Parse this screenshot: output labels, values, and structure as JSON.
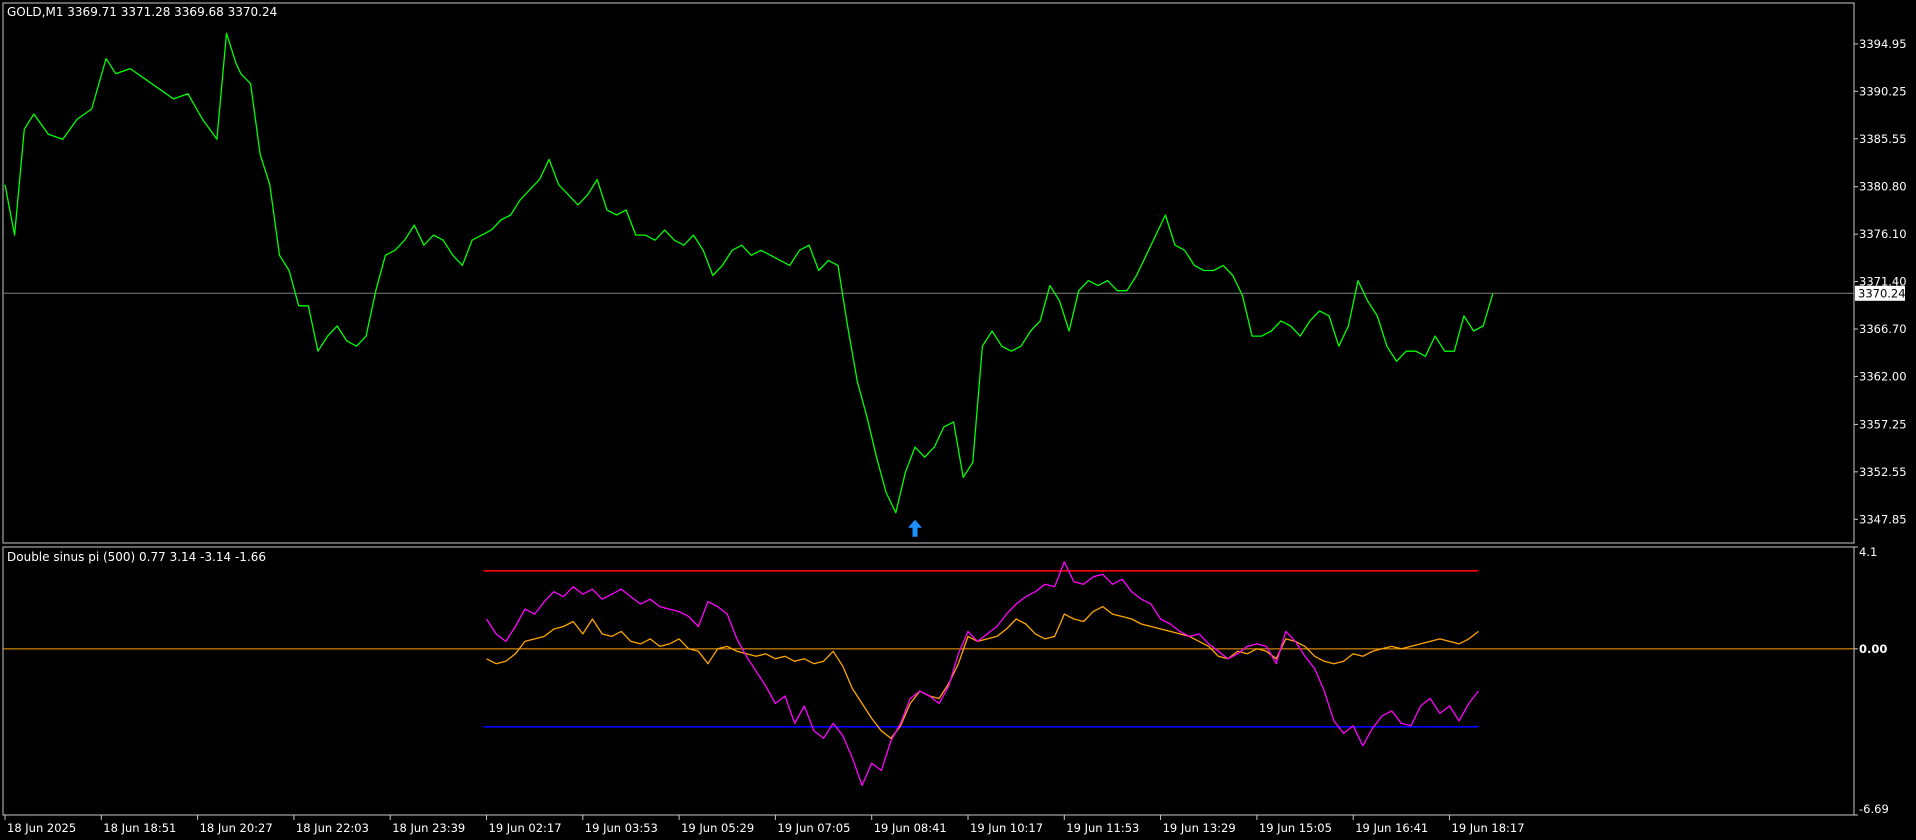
{
  "window": {
    "symbol_header": "GOLD,M1  3369.71 3371.28 3369.68 3370.24"
  },
  "colors": {
    "background": "#000000",
    "frame": "#c8c8c8",
    "price_line": "#00ff00",
    "current_price_line": "#7f7f7f",
    "price_tag_bg": "#ffffff",
    "price_tag_fg": "#000000",
    "arrow": "#1e90ff",
    "upper_level": "#ff0000",
    "lower_level": "#0000ff",
    "zero_level": "#ffa500",
    "series_a": "#ff00ff",
    "series_b": "#ffa500",
    "text": "#ffffff"
  },
  "chart_data": [
    {
      "type": "line",
      "title": "GOLD,M1  3369.71 3371.28 3369.68 3370.24",
      "ylim": [
        3345.5,
        3399.0
      ],
      "y_ticks": [
        "3394.95",
        "3390.25",
        "3385.55",
        "3380.80",
        "3376.10",
        "3371.40",
        "3366.70",
        "3362.00",
        "3357.25",
        "3352.55",
        "3347.85"
      ],
      "current_price": 3370.24,
      "current_price_label": "3370.24",
      "x_labels": [
        "18 Jun 2025",
        "18 Jun 18:51",
        "18 Jun 20:27",
        "18 Jun 22:03",
        "18 Jun 23:39",
        "19 Jun 02:17",
        "19 Jun 03:53",
        "19 Jun 05:29",
        "19 Jun 07:05",
        "19 Jun 08:41",
        "19 Jun 10:17",
        "19 Jun 11:53",
        "19 Jun 13:29",
        "19 Jun 15:05",
        "19 Jun 16:41",
        "19 Jun 18:17"
      ],
      "x_range": [
        0,
        15.78
      ],
      "arrow_marker": {
        "x": 9.45,
        "y": 3347.3,
        "type": "buy-arrow-up"
      },
      "series": [
        {
          "x": [
            0,
            0.1,
            0.2,
            0.3,
            0.45,
            0.6,
            0.75,
            0.9,
            1.05,
            1.15,
            1.3,
            1.45,
            1.6,
            1.75,
            1.9,
            2.05,
            2.2,
            2.3,
            2.4,
            2.45,
            2.55,
            2.65,
            2.75,
            2.85,
            2.95,
            3.05,
            3.15,
            3.25,
            3.35,
            3.45,
            3.55,
            3.65,
            3.75,
            3.85,
            3.95,
            4.05,
            4.15,
            4.25,
            4.35,
            4.45,
            4.55,
            4.65,
            4.75,
            4.85,
            4.95,
            5.05,
            5.15,
            5.25,
            5.35,
            5.45,
            5.55,
            5.65,
            5.75,
            5.85,
            5.95,
            6.05,
            6.15,
            6.25,
            6.35,
            6.45,
            6.55,
            6.65,
            6.75,
            6.85,
            6.95,
            7.05,
            7.15,
            7.25,
            7.35,
            7.45,
            7.55,
            7.65,
            7.75,
            7.85,
            7.95,
            8.05,
            8.15,
            8.25,
            8.35,
            8.45,
            8.55,
            8.65,
            8.75,
            8.85,
            8.95,
            9.05,
            9.15,
            9.25,
            9.35,
            9.45,
            9.55,
            9.65,
            9.75,
            9.85,
            9.95,
            10.05,
            10.15,
            10.25,
            10.35,
            10.45,
            10.55,
            10.65,
            10.75,
            10.85,
            10.95,
            11.05,
            11.15,
            11.25,
            11.35,
            11.45,
            11.55,
            11.65,
            11.75,
            11.85,
            11.95,
            12.05,
            12.15,
            12.25,
            12.35,
            12.45,
            12.55,
            12.65,
            12.75,
            12.85,
            12.95,
            13.05,
            13.15,
            13.25,
            13.35,
            13.45,
            13.55,
            13.65,
            13.75,
            13.85,
            13.95,
            14.05,
            14.15,
            14.25,
            14.35,
            14.45,
            14.55,
            14.65,
            14.75,
            14.85,
            14.95,
            15.05,
            15.15,
            15.25,
            15.35,
            15.45
          ],
          "values": [
            3381.0,
            3376.0,
            3386.5,
            3388.0,
            3386.0,
            3385.5,
            3387.5,
            3388.5,
            3393.5,
            3392.0,
            3392.5,
            3391.5,
            3390.5,
            3389.5,
            3390.0,
            3387.5,
            3385.5,
            3396.0,
            3393.0,
            3392.0,
            3391.0,
            3384.0,
            3381.0,
            3374.0,
            3372.5,
            3369.0,
            3369.0,
            3364.5,
            3366.0,
            3367.0,
            3365.5,
            3365.0,
            3366.0,
            3370.5,
            3374.0,
            3374.5,
            3375.5,
            3377.0,
            3375.0,
            3376.0,
            3375.5,
            3374.0,
            3373.0,
            3375.5,
            3376.0,
            3376.5,
            3377.5,
            3378.0,
            3379.5,
            3380.5,
            3381.5,
            3383.5,
            3381.0,
            3380.0,
            3379.0,
            3380.0,
            3381.5,
            3378.5,
            3378.0,
            3378.5,
            3376.0,
            3376.0,
            3375.5,
            3376.5,
            3375.5,
            3375.0,
            3376.0,
            3374.5,
            3372.0,
            3373.0,
            3374.5,
            3375.0,
            3374.0,
            3374.5,
            3374.0,
            3373.5,
            3373.0,
            3374.5,
            3375.0,
            3372.5,
            3373.5,
            3373.0,
            3367.0,
            3361.5,
            3358.0,
            3354.0,
            3350.5,
            3348.5,
            3352.5,
            3355.0,
            3354.0,
            3355.0,
            3357.0,
            3357.5,
            3352.0,
            3353.5,
            3365.0,
            3366.5,
            3365.0,
            3364.5,
            3365.0,
            3366.5,
            3367.5,
            3371.0,
            3369.5,
            3366.5,
            3370.5,
            3371.5,
            3371.0,
            3371.5,
            3370.5,
            3370.5,
            3372.0,
            3374.0,
            3376.0,
            3378.0,
            3375.0,
            3374.5,
            3373.0,
            3372.5,
            3372.5,
            3373.0,
            3372.0,
            3370.0,
            3366.0,
            3366.0,
            3366.5,
            3367.5,
            3367.0,
            3366.0,
            3367.5,
            3368.5,
            3368.0,
            3365.0,
            3367.0,
            3371.5,
            3369.5,
            3368.0,
            3365.0,
            3363.5,
            3364.5,
            3364.5,
            3364.0,
            3366.0,
            3364.5,
            3364.5,
            3368.0,
            3366.5,
            3367.0,
            3370.2
          ]
        }
      ]
    },
    {
      "type": "line",
      "title": "Double sinus pi (500) 0.77 3.14 -3.14 -1.66",
      "ylim": [
        -6.69,
        4.1
      ],
      "y_ticks": [
        "4.1",
        "0.00",
        "-6.69"
      ],
      "levels": [
        3.14,
        0.0,
        -3.14
      ],
      "x_range": [
        0,
        15.78
      ],
      "series": [
        {
          "x": [
            5.0,
            5.1,
            5.2,
            5.3,
            5.4,
            5.5,
            5.6,
            5.7,
            5.8,
            5.9,
            6.0,
            6.1,
            6.2,
            6.3,
            6.4,
            6.5,
            6.6,
            6.7,
            6.8,
            6.9,
            7.0,
            7.1,
            7.2,
            7.3,
            7.4,
            7.5,
            7.6,
            7.7,
            7.8,
            7.9,
            8.0,
            8.1,
            8.2,
            8.3,
            8.4,
            8.5,
            8.6,
            8.7,
            8.8,
            8.9,
            9.0,
            9.1,
            9.2,
            9.3,
            9.4,
            9.5,
            9.6,
            9.7,
            9.8,
            9.9,
            10.0,
            10.1,
            10.2,
            10.3,
            10.4,
            10.5,
            10.6,
            10.7,
            10.8,
            10.9,
            11.0,
            11.1,
            11.2,
            11.3,
            11.4,
            11.5,
            11.6,
            11.7,
            11.8,
            11.9,
            12.0,
            12.1,
            12.2,
            12.3,
            12.4,
            12.5,
            12.6,
            12.7,
            12.8,
            12.9,
            13.0,
            13.1,
            13.2,
            13.3,
            13.4,
            13.5,
            13.6,
            13.7,
            13.8,
            13.9,
            14.0,
            14.1,
            14.2,
            14.3,
            14.4,
            14.5,
            14.6,
            14.7,
            14.8,
            14.9,
            15.0,
            15.1,
            15.2,
            15.3
          ],
          "values": [
            1.2,
            0.6,
            0.3,
            0.9,
            1.6,
            1.4,
            1.9,
            2.3,
            2.1,
            2.5,
            2.2,
            2.4,
            2.0,
            2.2,
            2.4,
            2.1,
            1.8,
            2.0,
            1.7,
            1.6,
            1.5,
            1.3,
            0.9,
            1.9,
            1.7,
            1.4,
            0.4,
            -0.3,
            -0.9,
            -1.5,
            -2.2,
            -1.9,
            -3.0,
            -2.3,
            -3.3,
            -3.6,
            -3.0,
            -3.5,
            -4.4,
            -5.5,
            -4.6,
            -4.9,
            -3.7,
            -3.0,
            -2.0,
            -1.7,
            -1.9,
            -2.2,
            -1.5,
            -0.2,
            0.7,
            0.3,
            0.6,
            0.9,
            1.4,
            1.8,
            2.1,
            2.3,
            2.6,
            2.5,
            3.5,
            2.7,
            2.6,
            2.9,
            3.0,
            2.6,
            2.8,
            2.3,
            2.0,
            1.8,
            1.2,
            1.0,
            0.7,
            0.5,
            0.6,
            0.2,
            -0.1,
            -0.4,
            -0.2,
            0.1,
            0.2,
            0.1,
            -0.6,
            0.7,
            0.3,
            -0.3,
            -0.8,
            -1.7,
            -2.9,
            -3.4,
            -3.1,
            -3.9,
            -3.2,
            -2.7,
            -2.5,
            -3.0,
            -3.1,
            -2.3,
            -2.0,
            -2.6,
            -2.3,
            -2.9,
            -2.2,
            -1.7
          ]
        },
        {
          "x": [
            5.0,
            5.1,
            5.2,
            5.3,
            5.4,
            5.5,
            5.6,
            5.7,
            5.8,
            5.9,
            6.0,
            6.1,
            6.2,
            6.3,
            6.4,
            6.5,
            6.6,
            6.7,
            6.8,
            6.9,
            7.0,
            7.1,
            7.2,
            7.3,
            7.4,
            7.5,
            7.6,
            7.7,
            7.8,
            7.9,
            8.0,
            8.1,
            8.2,
            8.3,
            8.4,
            8.5,
            8.6,
            8.7,
            8.8,
            8.9,
            9.0,
            9.1,
            9.2,
            9.3,
            9.4,
            9.5,
            9.6,
            9.7,
            9.8,
            9.9,
            10.0,
            10.1,
            10.2,
            10.3,
            10.4,
            10.5,
            10.6,
            10.7,
            10.8,
            10.9,
            11.0,
            11.1,
            11.2,
            11.3,
            11.4,
            11.5,
            11.6,
            11.7,
            11.8,
            11.9,
            12.0,
            12.1,
            12.2,
            12.3,
            12.4,
            12.5,
            12.6,
            12.7,
            12.8,
            12.9,
            13.0,
            13.1,
            13.2,
            13.3,
            13.4,
            13.5,
            13.6,
            13.7,
            13.8,
            13.9,
            14.0,
            14.1,
            14.2,
            14.3,
            14.4,
            14.5,
            14.6,
            14.7,
            14.8,
            14.9,
            15.0,
            15.1,
            15.2,
            15.3
          ],
          "values": [
            -0.4,
            -0.6,
            -0.5,
            -0.2,
            0.3,
            0.4,
            0.5,
            0.8,
            0.9,
            1.1,
            0.6,
            1.2,
            0.6,
            0.5,
            0.7,
            0.3,
            0.2,
            0.4,
            0.1,
            0.2,
            0.4,
            0.0,
            -0.1,
            -0.6,
            0.0,
            0.1,
            -0.1,
            -0.2,
            -0.3,
            -0.2,
            -0.4,
            -0.3,
            -0.5,
            -0.4,
            -0.6,
            -0.5,
            -0.1,
            -0.7,
            -1.6,
            -2.2,
            -2.8,
            -3.3,
            -3.6,
            -3.1,
            -2.2,
            -1.7,
            -1.9,
            -2.0,
            -1.4,
            -0.6,
            0.5,
            0.3,
            0.4,
            0.5,
            0.8,
            1.2,
            1.0,
            0.6,
            0.4,
            0.5,
            1.4,
            1.2,
            1.1,
            1.5,
            1.7,
            1.4,
            1.3,
            1.2,
            1.0,
            0.9,
            0.8,
            0.7,
            0.6,
            0.5,
            0.3,
            0.1,
            -0.3,
            -0.4,
            -0.1,
            -0.2,
            0.0,
            -0.1,
            -0.4,
            0.4,
            0.3,
            0.1,
            -0.3,
            -0.5,
            -0.6,
            -0.5,
            -0.2,
            -0.3,
            -0.1,
            0.0,
            0.1,
            0.0,
            0.1,
            0.2,
            0.3,
            0.4,
            0.3,
            0.2,
            0.4,
            0.7
          ]
        }
      ]
    }
  ]
}
